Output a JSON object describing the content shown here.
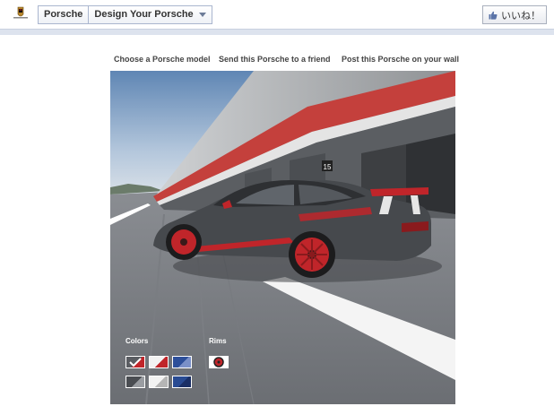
{
  "topbar": {
    "page_name": "Porsche",
    "app_name": "Design Your Porsche",
    "like_label": "いいね！"
  },
  "nav": {
    "choose_model": "Choose a Porsche model",
    "send_friend": "Send this Porsche to a friend",
    "post_wall": "Post this Porsche on your wall"
  },
  "configurator": {
    "colors_label": "Colors",
    "rims_label": "Rims",
    "garage_number": "15",
    "color_swatches": [
      {
        "name": "grey-red",
        "fill": "#5a5d62",
        "accent": "#c0252a",
        "selected": true
      },
      {
        "name": "white-red",
        "fill": "#f2f2f2",
        "accent": "#c0252a"
      },
      {
        "name": "blue",
        "fill": "#2d4f9a",
        "accent": "#7a90c8"
      },
      {
        "name": "dark-grey",
        "fill": "#4a4d52",
        "accent": "#9a9da2"
      },
      {
        "name": "white-silver",
        "fill": "#f2f2f2",
        "accent": "#b5b5b5"
      },
      {
        "name": "blue-dark",
        "fill": "#294b93",
        "accent": "#1a2f66"
      }
    ],
    "rim_swatch": {
      "name": "red-rim",
      "fill": "#ffffff",
      "accent": "#c0252a"
    }
  }
}
